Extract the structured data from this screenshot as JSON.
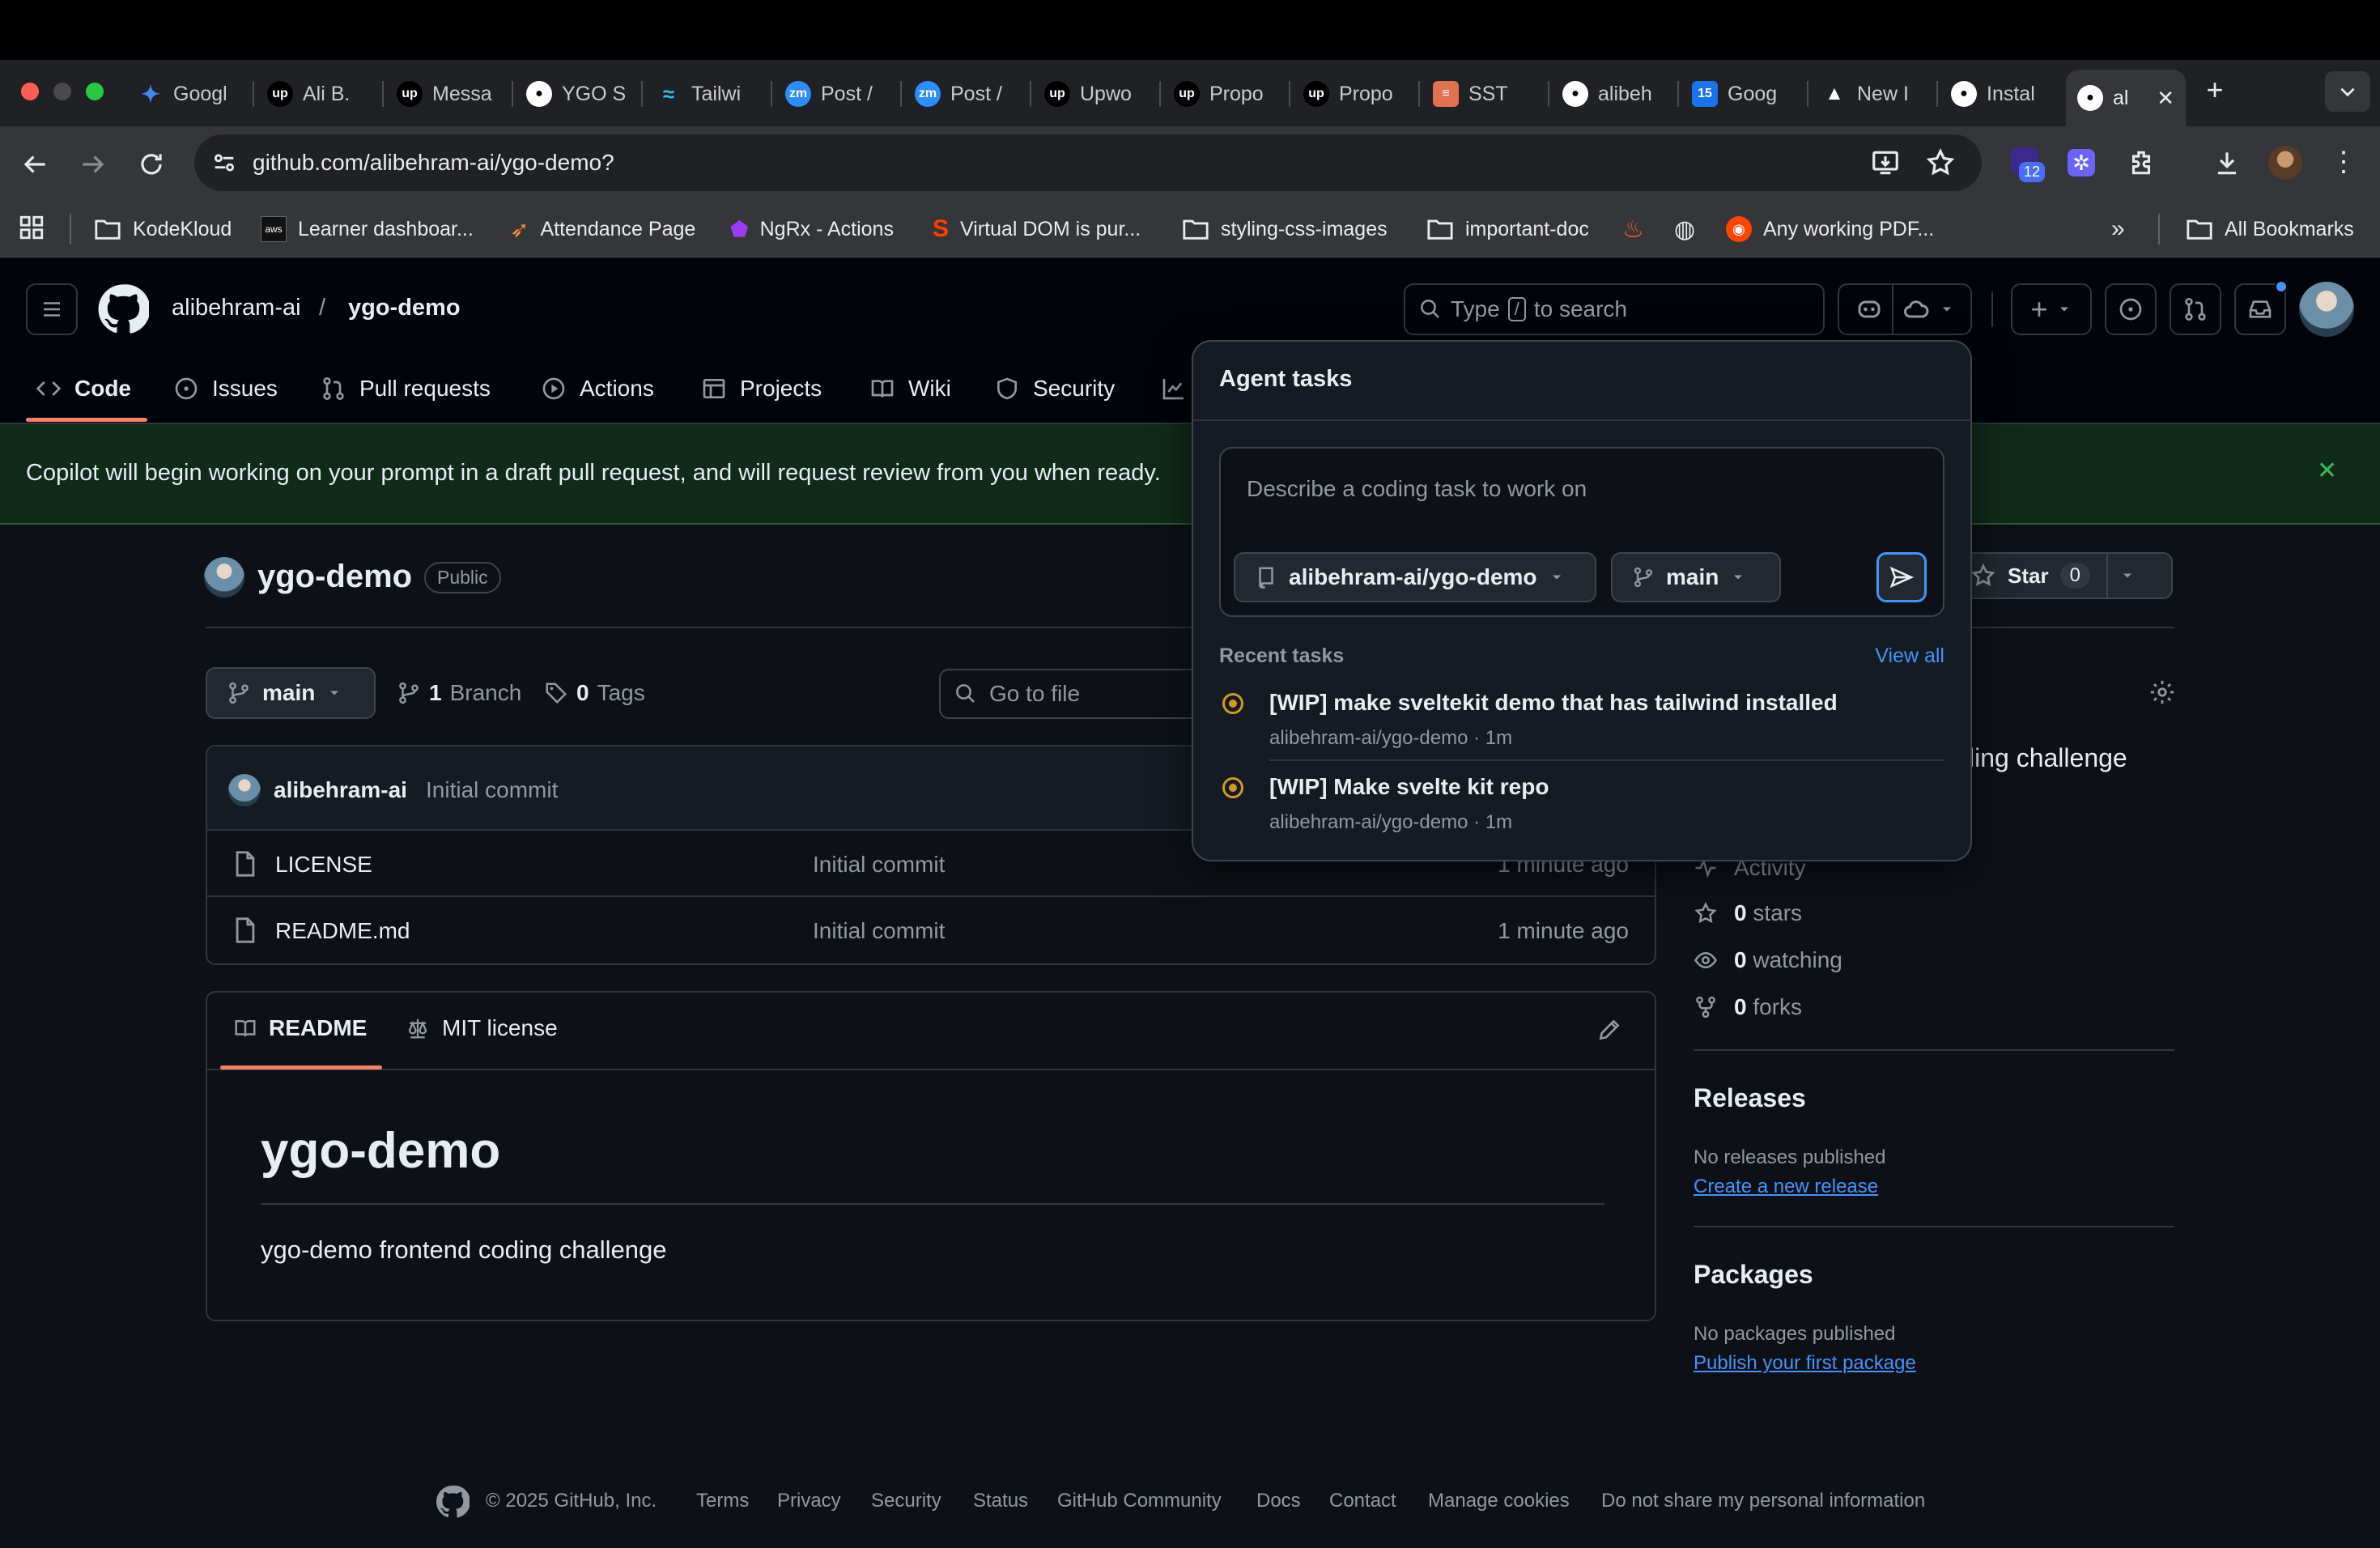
{
  "browser": {
    "tabs": [
      {
        "label": "Googl",
        "icon": "gemini-icon",
        "color": "#4285f4"
      },
      {
        "label": "Ali B.",
        "icon": "upwork-icon",
        "color": "#000000"
      },
      {
        "label": "Messa",
        "icon": "upwork-icon",
        "color": "#000000"
      },
      {
        "label": "YGO S",
        "icon": "github-icon",
        "color": "#ffffff"
      },
      {
        "label": "Tailwi",
        "icon": "tailwind-icon",
        "color": "#38bdf8"
      },
      {
        "label": "Post /",
        "icon": "zoom-icon",
        "color": "#2d8cff"
      },
      {
        "label": "Post /",
        "icon": "zoom-icon",
        "color": "#2d8cff"
      },
      {
        "label": "Upwo",
        "icon": "upwork-icon",
        "color": "#000000"
      },
      {
        "label": "Propo",
        "icon": "upwork-icon",
        "color": "#000000"
      },
      {
        "label": "Propo",
        "icon": "upwork-icon",
        "color": "#000000"
      },
      {
        "label": "SST",
        "icon": "sst-icon",
        "color": "#e27152"
      },
      {
        "label": "alibeh",
        "icon": "github-icon",
        "color": "#ffffff"
      },
      {
        "label": "Goog",
        "icon": "google-calendar-icon",
        "color": "#1a73e8"
      },
      {
        "label": "New I",
        "icon": "vercel-icon",
        "color": "#ffffff"
      },
      {
        "label": "Instal",
        "icon": "github-icon",
        "color": "#ffffff"
      },
      {
        "label": "al",
        "icon": "github-icon",
        "color": "#ffffff"
      }
    ],
    "url": "github.com/alibehram-ai/ygo-demo?",
    "extension_badge": "12",
    "bookmarks": [
      {
        "label": "KodeKloud",
        "icon": "folder-icon"
      },
      {
        "label": "Learner dashboar...",
        "icon": "aws-icon"
      },
      {
        "label": "Attendance Page",
        "icon": "rocket-icon"
      },
      {
        "label": "NgRx - Actions",
        "icon": "ngrx-icon"
      },
      {
        "label": "Virtual DOM is pur...",
        "icon": "svelte-icon"
      },
      {
        "label": "styling-css-images",
        "icon": "folder-icon"
      },
      {
        "label": "important-doc",
        "icon": "folder-icon"
      },
      {
        "label": "",
        "icon": "fire-icon"
      },
      {
        "label": "",
        "icon": "globe-icon"
      },
      {
        "label": "Any working PDF...",
        "icon": "reddit-icon"
      }
    ],
    "all_bookmarks": "All Bookmarks",
    "overflow": "»"
  },
  "header": {
    "owner": "alibehram-ai",
    "slash": "/",
    "repo": "ygo-demo",
    "search_text": "Type",
    "search_key": "/",
    "search_suffix": "to search",
    "plus": "+"
  },
  "repo_nav": [
    {
      "label": "Code",
      "icon": "code-icon"
    },
    {
      "label": "Issues",
      "icon": "issue-icon"
    },
    {
      "label": "Pull requests",
      "icon": "pull-request-icon"
    },
    {
      "label": "Actions",
      "icon": "play-icon"
    },
    {
      "label": "Projects",
      "icon": "table-icon"
    },
    {
      "label": "Wiki",
      "icon": "book-icon"
    },
    {
      "label": "Security",
      "icon": "shield-icon"
    }
  ],
  "banner": {
    "message": "Copilot will begin working on your prompt in a draft pull request, and will request review from you when ready."
  },
  "repo": {
    "name": "ygo-demo",
    "visibility": "Public",
    "star_label": "Star",
    "star_count": "0",
    "branch": "main",
    "branches_count": "1",
    "branches_label": "Branch",
    "tags_count": "0",
    "tags_label": "Tags",
    "goto_placeholder": "Go to file",
    "commit_author": "alibehram-ai",
    "commit_message": "Initial commit",
    "files": [
      {
        "name": "LICENSE",
        "message": "Initial commit",
        "time": "1 minute ago"
      },
      {
        "name": "README.md",
        "message": "Initial commit",
        "time": "1 minute ago"
      }
    ]
  },
  "readme": {
    "tab_readme": "README",
    "tab_license": "MIT license",
    "title": "ygo-demo",
    "body": "ygo-demo frontend coding challenge"
  },
  "sidebar": {
    "about_tail": "ling challenge",
    "activity": "Activity",
    "stars_count": "0",
    "stars_label": "stars",
    "watching_count": "0",
    "watching_label": "watching",
    "forks_count": "0",
    "forks_label": "forks",
    "releases_title": "Releases",
    "releases_empty": "No releases published",
    "releases_link": "Create a new release",
    "packages_title": "Packages",
    "packages_empty": "No packages published",
    "packages_link": "Publish your first package"
  },
  "agent": {
    "title": "Agent tasks",
    "placeholder": "Describe a coding task to work on",
    "repo_select": "alibehram-ai/ygo-demo",
    "branch_select": "main",
    "recent_label": "Recent tasks",
    "view_all": "View all",
    "tasks": [
      {
        "title": "[WIP] make sveltekit demo that has tailwind installed",
        "meta": "alibehram-ai/ygo-demo · 1m"
      },
      {
        "title": "[WIP] Make svelte kit repo",
        "meta": "alibehram-ai/ygo-demo · 1m"
      }
    ]
  },
  "footer": {
    "copyright": "© 2025 GitHub, Inc.",
    "links": [
      "Terms",
      "Privacy",
      "Security",
      "Status",
      "GitHub Community",
      "Docs",
      "Contact",
      "Manage cookies",
      "Do not share my personal information"
    ]
  },
  "colors": {
    "accent_link": "#4493f8",
    "nav_underline": "#f78166",
    "wip_dot": "#d29922",
    "banner_bg": "#102b1a"
  }
}
